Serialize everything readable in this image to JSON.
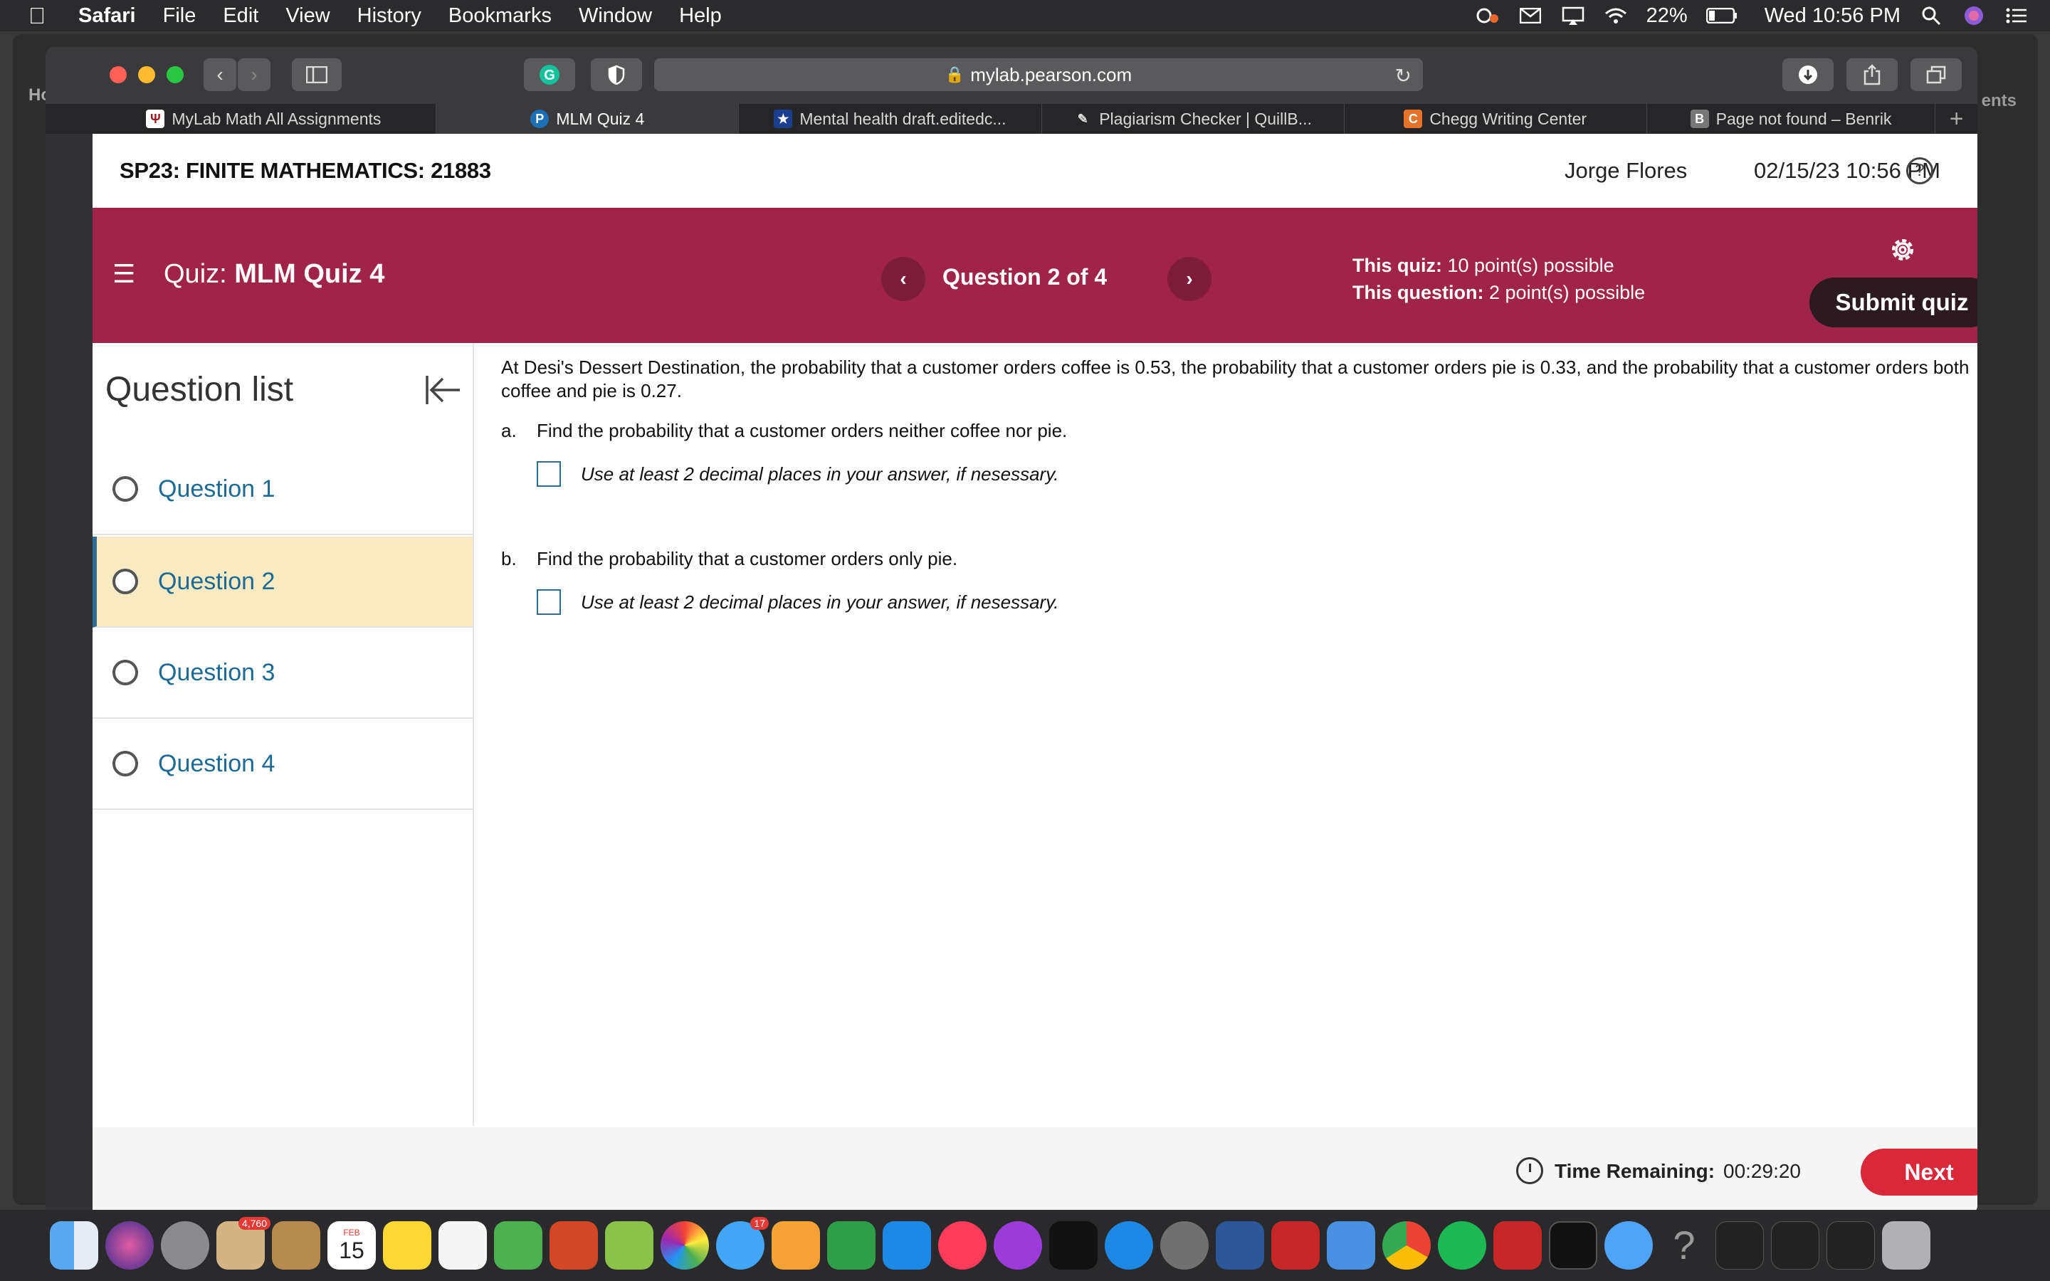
{
  "menubar": {
    "app": "Safari",
    "items": [
      "File",
      "Edit",
      "View",
      "History",
      "Bookmarks",
      "Window",
      "Help"
    ],
    "battery": "22%",
    "clock": "Wed 10:56 PM"
  },
  "background_window": {
    "left_text": "Hor",
    "right_text": "ents"
  },
  "browser": {
    "url": "mylab.pearson.com",
    "tabs": [
      {
        "label": "MyLab Math All Assignments",
        "fav": "Ψ",
        "color": "#9c1a1a"
      },
      {
        "label": "MLM Quiz 4",
        "fav": "P",
        "color": "#1c6fb5"
      },
      {
        "label": "Mental health draft.editedc...",
        "fav": "★",
        "color": "#1a3f8f"
      },
      {
        "label": "Plagiarism Checker | QuillB...",
        "fav": "✎",
        "color": "#555555"
      },
      {
        "label": "Chegg Writing Center",
        "fav": "C",
        "color": "#e3742a"
      },
      {
        "label": "Page not found – Benrik",
        "fav": "B",
        "color": "#777777"
      }
    ]
  },
  "header": {
    "course": "SP23: FINITE MATHEMATICS: 21883",
    "user": "Jorge Flores",
    "datetime": "02/15/23 10:56 PM",
    "help": "?"
  },
  "quizbar": {
    "quiz_prefix": "Quiz:",
    "quiz_name": "MLM Quiz 4",
    "question_counter": "Question 2 of 4",
    "quiz_points_label": "This quiz:",
    "quiz_points": "10 point(s) possible",
    "question_points_label": "This question:",
    "question_points": "2 point(s) possible",
    "submit": "Submit quiz"
  },
  "sidebar": {
    "title": "Question list",
    "questions": [
      "Question 1",
      "Question 2",
      "Question 3",
      "Question 4"
    ],
    "active_index": 1
  },
  "question": {
    "stem": "At Desi's Dessert Destination, the probability that a customer orders coffee is 0.53, the probability that a customer orders pie is 0.33, and the probability that a customer orders both coffee and pie is 0.27.",
    "parts": [
      {
        "label": "a.",
        "text": "Find the probability that a customer orders neither coffee nor pie.",
        "hint": "Use at least 2 decimal places in your answer, if nesessary."
      },
      {
        "label": "b.",
        "text": "Find the probability that a customer orders only pie.",
        "hint": "Use at least 2 decimal places in your answer, if nesessary."
      }
    ]
  },
  "footer": {
    "timer_label": "Time Remaining:",
    "timer_value": "00:29:20",
    "next": "Next"
  },
  "dock": {
    "apps": [
      "finder-icon",
      "siri-icon",
      "launchpad-icon",
      "mail-app-icon",
      "contacts-icon",
      "calendar-icon",
      "notes-icon",
      "reminders-icon",
      "facetime-icon",
      "powerpoint-icon",
      "maps-icon",
      "photos-icon",
      "messages-icon",
      "pages-icon",
      "numbers-icon",
      "keynote-icon",
      "music-icon",
      "podcasts-icon",
      "tv-icon",
      "appstore-icon",
      "settings-icon",
      "word-icon",
      "acrobat-icon",
      "mail-icon",
      "chrome-icon",
      "spotify-icon",
      "acrobat2-icon",
      "terminal-icon",
      "safari-icon",
      "help-app-icon",
      "window-thumb-icon",
      "window-thumb2-icon",
      "window-thumb3-icon",
      "trash-icon"
    ],
    "calendar_month": "FEB",
    "calendar_day": "15",
    "mail_badge": "4,760",
    "messages_badge": "17"
  }
}
